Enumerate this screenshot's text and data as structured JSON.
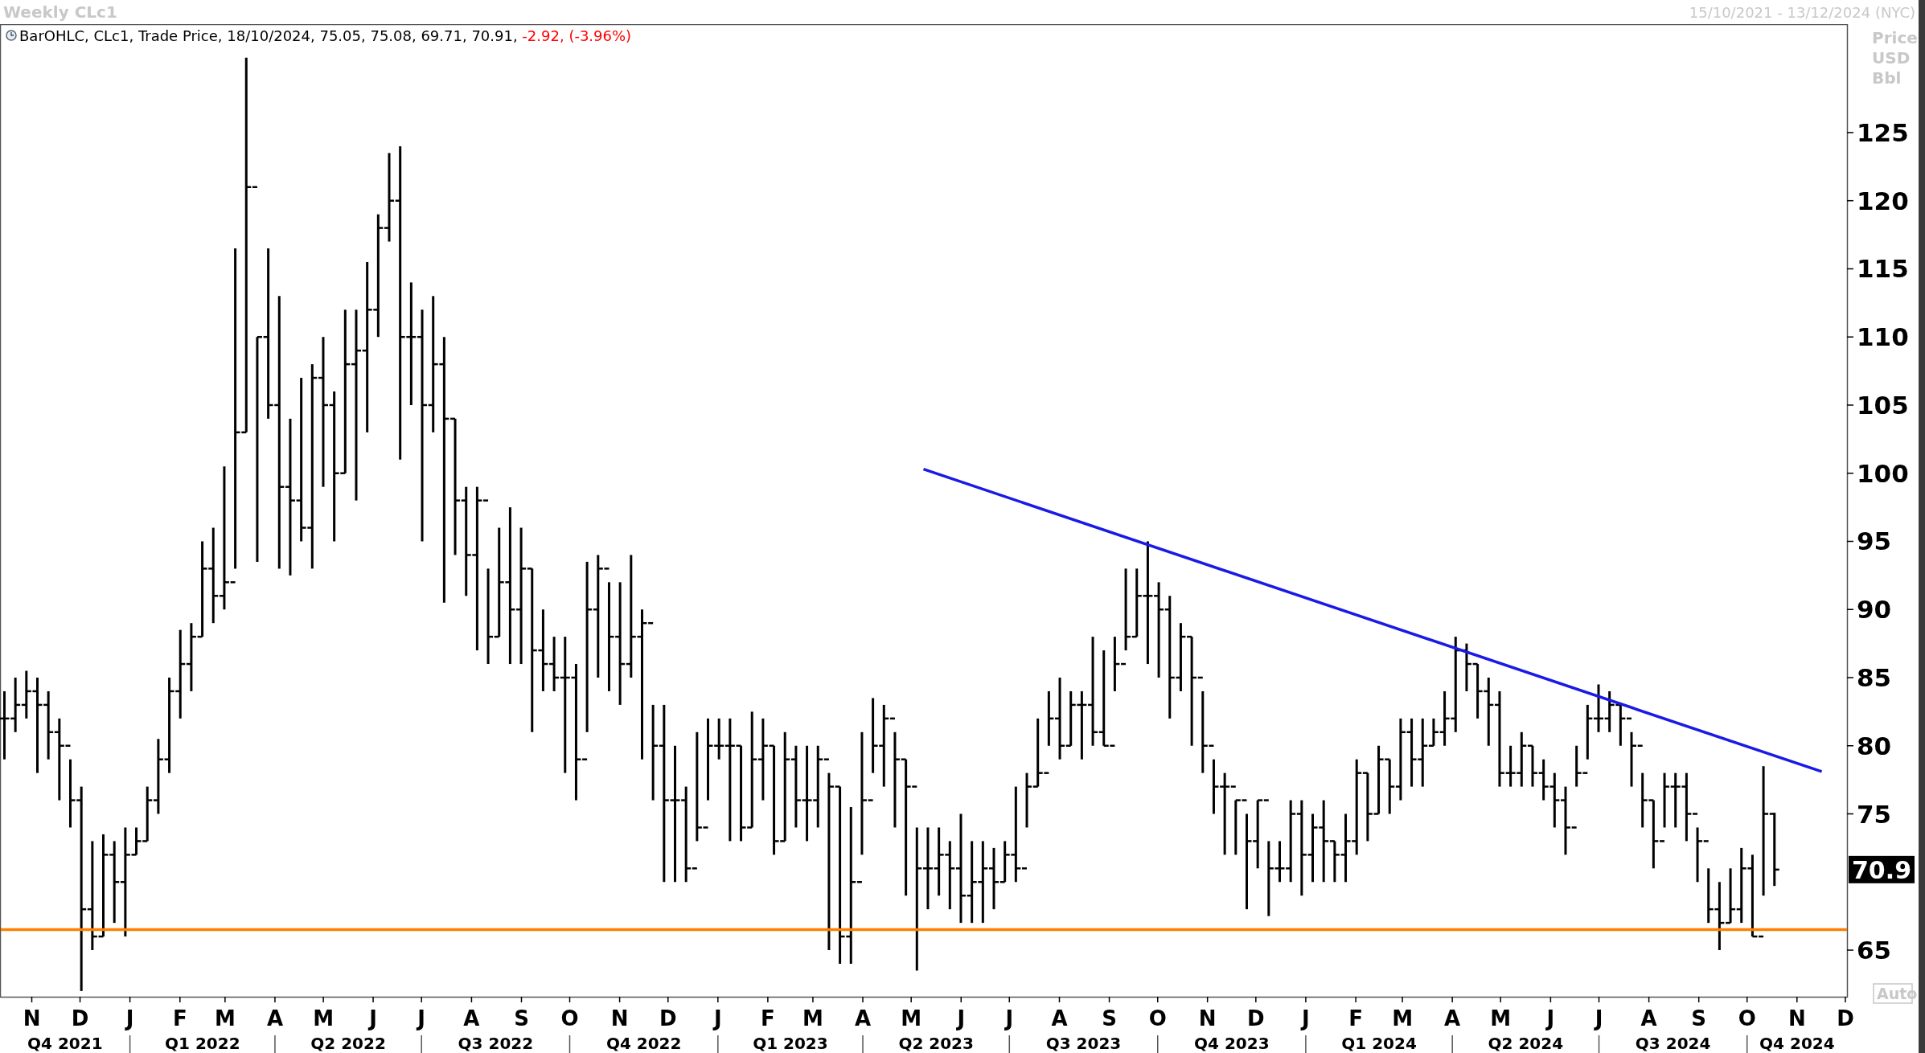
{
  "header": {
    "title": "Weekly CLc1",
    "range": "15/10/2021 - 13/12/2024 (NYC)"
  },
  "legend": {
    "text": "BarOHLC, CLc1, Trade Price, 18/10/2024, 75.05, 75.08, 69.71, 70.91,",
    "change": "-2.92, (-3.96%)"
  },
  "axis_units": [
    "Price",
    "USD",
    "Bbl"
  ],
  "scale_button": "Auto",
  "last_price": {
    "label": "70.9"
  },
  "y_axis": {
    "labels": [
      "125",
      "120",
      "115",
      "110",
      "105",
      "100",
      "95",
      "90",
      "85",
      "80",
      "75",
      "65"
    ]
  },
  "x_axis": {
    "months": [
      "N",
      "D",
      "J",
      "F",
      "M",
      "A",
      "M",
      "J",
      "J",
      "A",
      "S",
      "O",
      "N",
      "D",
      "J",
      "F",
      "M",
      "A",
      "M",
      "J",
      "J",
      "A",
      "S",
      "O",
      "N",
      "D",
      "J",
      "F",
      "M",
      "A",
      "M",
      "J",
      "J",
      "A",
      "S",
      "O",
      "N",
      "D"
    ],
    "quarters": [
      "Q4 2021",
      "Q1 2022",
      "Q2 2022",
      "Q3 2022",
      "Q4 2022",
      "Q1 2023",
      "Q2 2023",
      "Q3 2023",
      "Q4 2023",
      "Q1 2024",
      "Q2 2024",
      "Q3 2024",
      "Q4 2024"
    ]
  }
}
